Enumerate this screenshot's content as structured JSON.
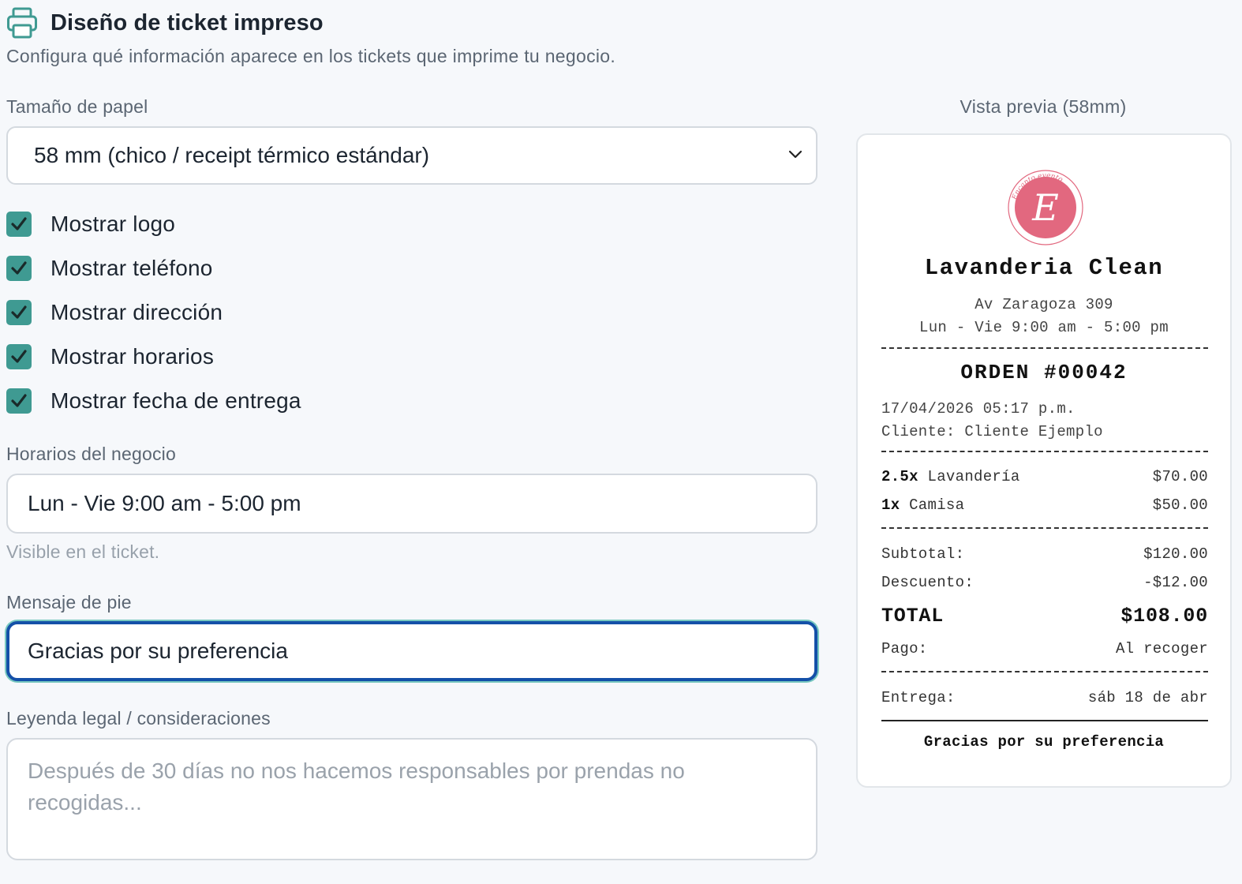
{
  "header": {
    "title": "Diseño de ticket impreso",
    "subtitle": "Configura qué información aparece en los tickets que imprime tu negocio."
  },
  "paper": {
    "label": "Tamaño de papel",
    "selected": "58 mm (chico / receipt térmico estándar)"
  },
  "options": [
    {
      "label": "Mostrar logo",
      "checked": true
    },
    {
      "label": "Mostrar teléfono",
      "checked": true
    },
    {
      "label": "Mostrar dirección",
      "checked": true
    },
    {
      "label": "Mostrar horarios",
      "checked": true
    },
    {
      "label": "Mostrar fecha de entrega",
      "checked": true
    }
  ],
  "hours": {
    "label": "Horarios del negocio",
    "value": "Lun - Vie 9:00 am - 5:00 pm",
    "hint": "Visible en el ticket."
  },
  "footer_message": {
    "label": "Mensaje de pie",
    "value": "Gracias por su preferencia"
  },
  "legal": {
    "label": "Leyenda legal / consideraciones",
    "placeholder": "Después de 30 días no nos hacemos responsables por prendas no recogidas..."
  },
  "preview": {
    "title": "Vista previa (58mm)",
    "logo_text": "Encanto evento",
    "logo_letter": "E",
    "business_name": "Lavanderia Clean",
    "address": "Av Zaragoza 309",
    "hours": "Lun - Vie 9:00 am - 5:00 pm",
    "order": "ORDEN #00042",
    "datetime": "17/04/2026 05:17 p.m.",
    "customer": "Cliente: Cliente Ejemplo",
    "items": [
      {
        "qty": "2.5x",
        "name": "Lavandería",
        "price": "$70.00"
      },
      {
        "qty": "1x",
        "name": "Camisa",
        "price": "$50.00"
      }
    ],
    "subtotal_label": "Subtotal:",
    "subtotal": "$120.00",
    "discount_label": "Descuento:",
    "discount": "-$12.00",
    "total_label": "TOTAL",
    "total": "$108.00",
    "payment_label": "Pago:",
    "payment": "Al recoger",
    "delivery_label": "Entrega:",
    "delivery": "sáb 18 de abr",
    "footer": "Gracias por su preferencia"
  },
  "colors": {
    "accent": "#3f9a92",
    "focus": "#1450a8",
    "logo_pink": "#e2687f"
  },
  "icons": {
    "header": "printer-icon",
    "select": "chevron-down-icon",
    "checkbox": "checkmark-icon"
  }
}
